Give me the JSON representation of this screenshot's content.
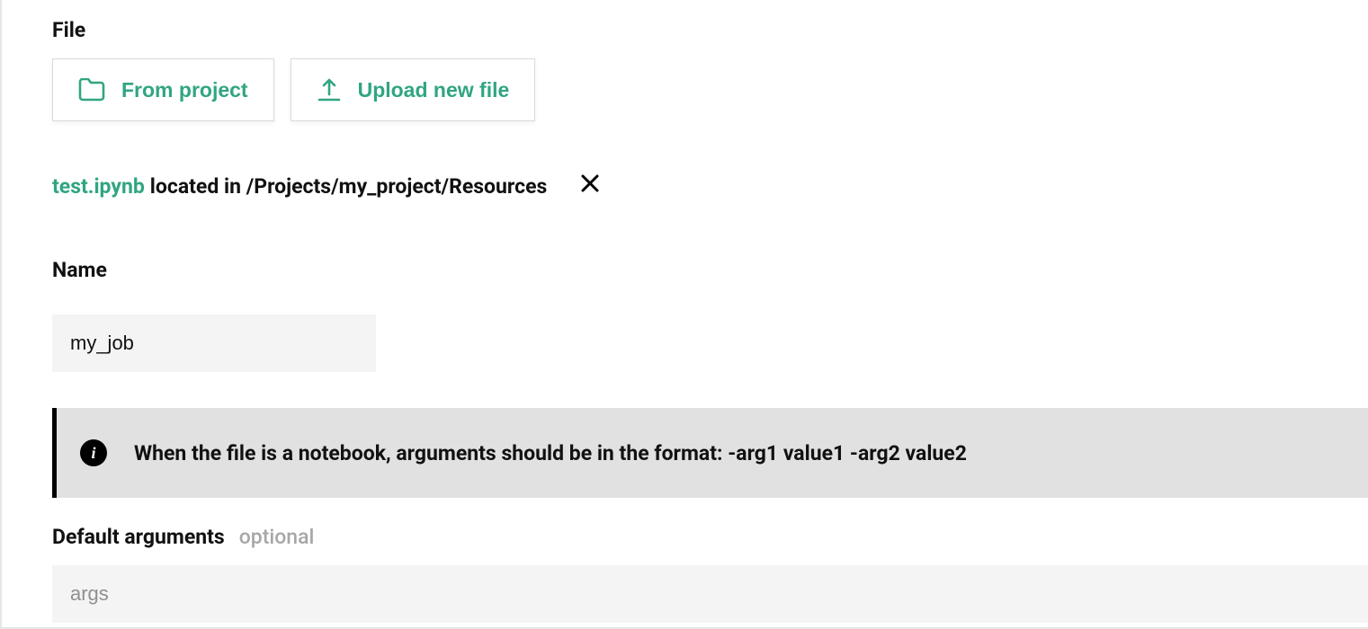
{
  "file": {
    "section_label": "File",
    "from_project_label": "From project",
    "upload_label": "Upload new file",
    "selected_filename": "test.ipynb",
    "located_text": "located in /Projects/my_project/Resources"
  },
  "name": {
    "section_label": "Name",
    "value": "my_job"
  },
  "info_banner": {
    "text": "When the file is a notebook, arguments should be in the format: -arg1 value1 -arg2 value2"
  },
  "args": {
    "section_label": "Default arguments",
    "optional_tag": "optional",
    "placeholder": "args",
    "value": ""
  },
  "colors": {
    "accent": "#30a582"
  }
}
